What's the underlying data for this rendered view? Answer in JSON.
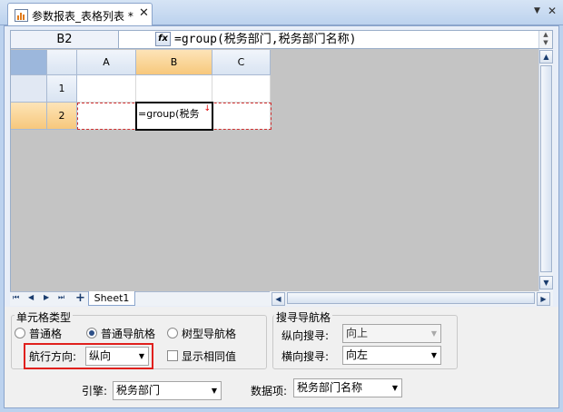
{
  "tab": {
    "title": "参数报表_表格列表 *",
    "close": "✕"
  },
  "window_controls": {
    "dropdown": "▼",
    "close": "✕"
  },
  "formula_bar": {
    "cell_ref": "B2",
    "fx": "fx",
    "formula": "=group(税务部门,税务部门名称)"
  },
  "sheet": {
    "columns": [
      "A",
      "B",
      "C"
    ],
    "rows": [
      "1",
      "2"
    ],
    "active_cell_text": "=group(税务",
    "expand_marker": "↓",
    "selected_col": "B",
    "selected_row": "2"
  },
  "sheet_tabs": {
    "nav": [
      "⏮",
      "◀",
      "▶",
      "⏭",
      "+"
    ],
    "active": "Sheet1"
  },
  "cell_type": {
    "group_label": "单元格类型",
    "options": [
      "普通格",
      "普通导航格",
      "树型导航格"
    ],
    "selected": "普通导航格",
    "direction_label": "航行方向:",
    "direction_value": "纵向",
    "show_same_label": "显示相同值"
  },
  "search_nav": {
    "group_label": "搜寻导航格",
    "vertical_label": "纵向搜寻:",
    "vertical_value": "向上",
    "horizontal_label": "横向搜寻:",
    "horizontal_value": "向左"
  },
  "engine": {
    "label": "引擎:",
    "value": "税务部门"
  },
  "data_item": {
    "label": "数据项:",
    "value": "税务部门名称"
  },
  "colors": {
    "selected_header": "#f7c87c",
    "highlight_border": "#e0201d",
    "tab_bar": "#bcd2ee"
  }
}
